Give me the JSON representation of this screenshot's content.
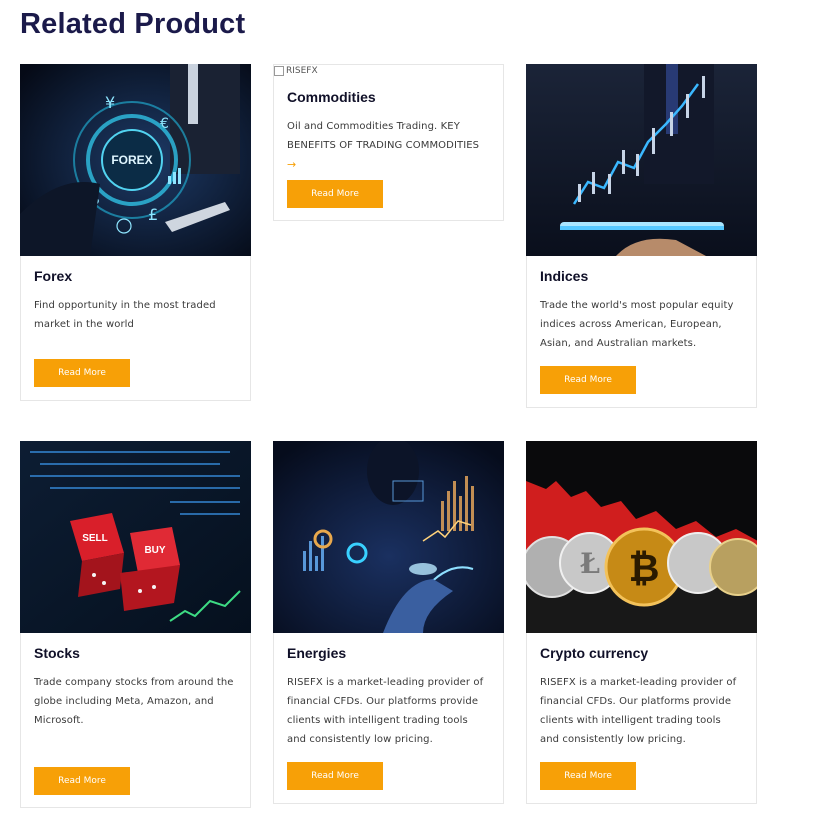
{
  "page": {
    "title": "Related Product"
  },
  "products": [
    {
      "title": "Forex",
      "description": "Find opportunity in the most traded market in the world",
      "button": "Read More",
      "image_alt": "Forex"
    },
    {
      "title": "Commodities",
      "description": "Oil and Commodities Trading. KEY BENEFITS OF TRADING COMMODITIES",
      "button": "Read More",
      "image_alt": "RISEFX"
    },
    {
      "title": "Indices",
      "description": "Trade the world's most popular equity indices across American, European, Asian, and Australian markets.",
      "button": "Read More",
      "image_alt": "Indices"
    },
    {
      "title": "Stocks",
      "description": "Trade company stocks from around the globe including Meta, Amazon, and Microsoft.",
      "button": "Read More",
      "image_alt": "Stocks"
    },
    {
      "title": "Energies",
      "description": "RISEFX is a market-leading provider of financial CFDs. Our platforms provide clients with intelligent trading tools and consistently low pricing.",
      "button": "Read More",
      "image_alt": "Energies"
    },
    {
      "title": "Crypto currency",
      "description": "RISEFX is a market-leading provider of financial CFDs. Our platforms provide clients with intelligent trading tools and consistently low pricing.",
      "button": "Read More",
      "image_alt": "Crypto currency"
    }
  ],
  "image_text": {
    "forex": "FOREX",
    "sell": "SELL",
    "buy": "BUY"
  },
  "colors": {
    "accent": "#f7a007",
    "title": "#1b1a4a"
  }
}
